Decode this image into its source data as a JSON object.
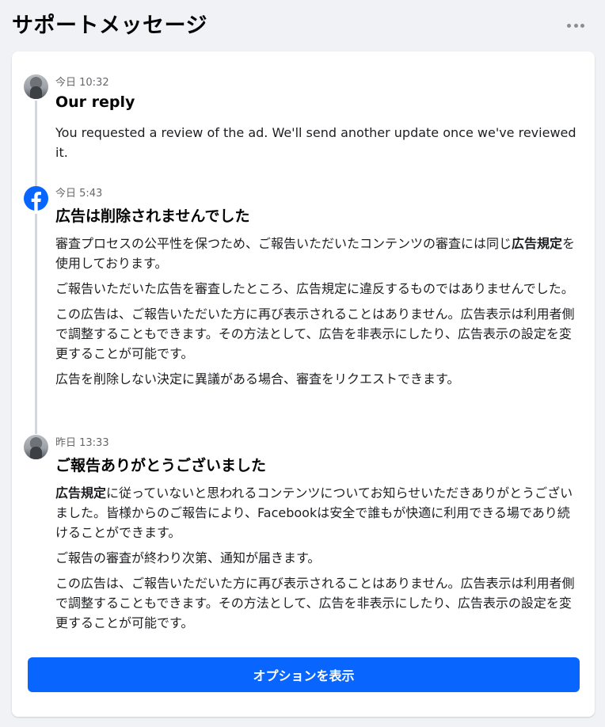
{
  "header": {
    "title": "サポートメッセージ",
    "more_icon": "more-horizontal-icon"
  },
  "messages": [
    {
      "sender_icon": "user-avatar",
      "time": "今日 10:32",
      "title": "Our reply",
      "paragraphs": [
        "You requested a review of the ad. We'll send another update once we've reviewed it."
      ]
    },
    {
      "sender_icon": "facebook-logo-icon",
      "time": "今日 5:43",
      "title": "広告は削除されませんでした",
      "p1_before": "審査プロセスの公平性を保つため、ご報告いただいたコンテンツの審査には同じ",
      "p1_bold": "広告規定",
      "p1_after": "を使用しております。",
      "paragraphs": [
        "ご報告いただいた広告を審査したところ、広告規定に違反するものではありませんでした。",
        "この広告は、ご報告いただいた方に再び表示されることはありません。広告表示は利用者側で調整することもできます。その方法として、広告を非表示にしたり、広告表示の設定を変更することが可能です。",
        "広告を削除しない決定に異議がある場合、審査をリクエストできます。"
      ]
    },
    {
      "sender_icon": "user-avatar",
      "time": "昨日 13:33",
      "title": "ご報告ありがとうございました",
      "p1_bold": "広告規定",
      "p1_after": "に従っていないと思われるコンテンツについてお知らせいただきありがとうございました。皆様からのご報告により、Facebookは安全で誰もが快適に利用できる場であり続けることができます。",
      "paragraphs": [
        "ご報告の審査が終わり次第、通知が届きます。",
        "この広告は、ご報告いただいた方に再び表示されることはありません。広告表示は利用者側で調整することもできます。その方法として、広告を非表示にしたり、広告表示の設定を変更することが可能です。"
      ]
    }
  ],
  "footer": {
    "show_options_label": "オプションを表示"
  },
  "colors": {
    "page_background": "#f0f2f5",
    "card_background": "#ffffff",
    "primary_button": "#0866ff",
    "facebook_blue": "#0866ff",
    "timeline_line": "#d3d6db",
    "secondary_text": "#65676b"
  }
}
